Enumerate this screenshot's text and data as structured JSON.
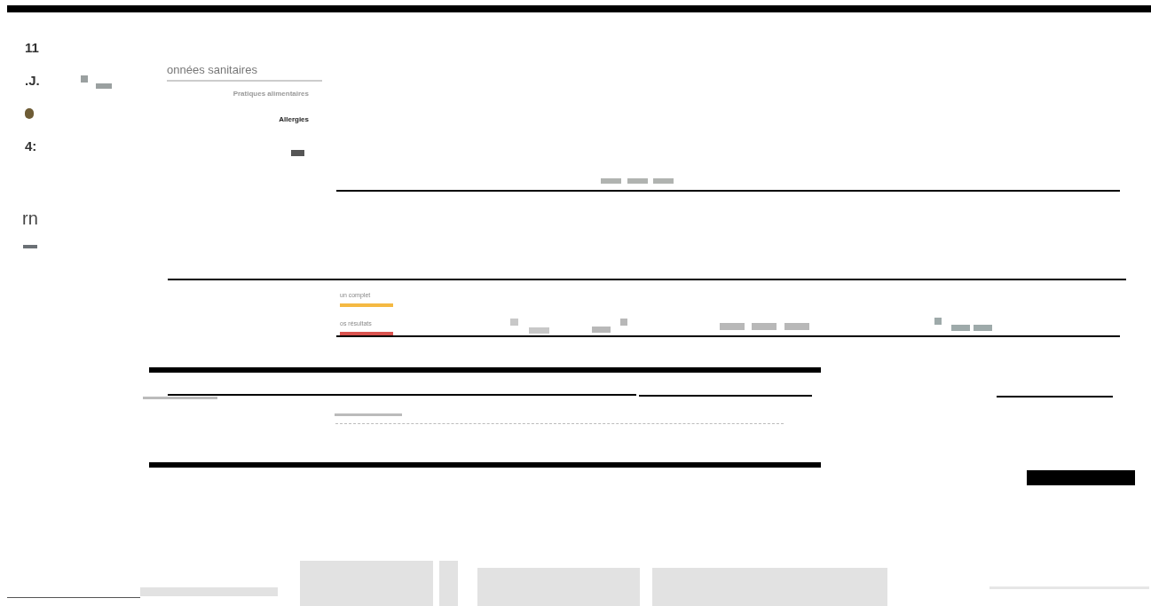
{
  "side_labels": [
    {
      "kind": "text",
      "text": "11"
    },
    {
      "kind": "text",
      "text": ".J."
    },
    {
      "kind": "dot",
      "color": "#6e5c35"
    },
    {
      "kind": "text",
      "text": "4:"
    }
  ],
  "heading": "onnées sanitaires",
  "menu_items": [
    {
      "label": "Pratiques alimentaires",
      "selected": false
    },
    {
      "label": "Allergies",
      "selected": true
    }
  ],
  "glyph": "rn",
  "strip": [
    {
      "label": "un complet",
      "color": "#f5b942"
    },
    {
      "label": "os résultats",
      "color": "#d9534f"
    }
  ]
}
